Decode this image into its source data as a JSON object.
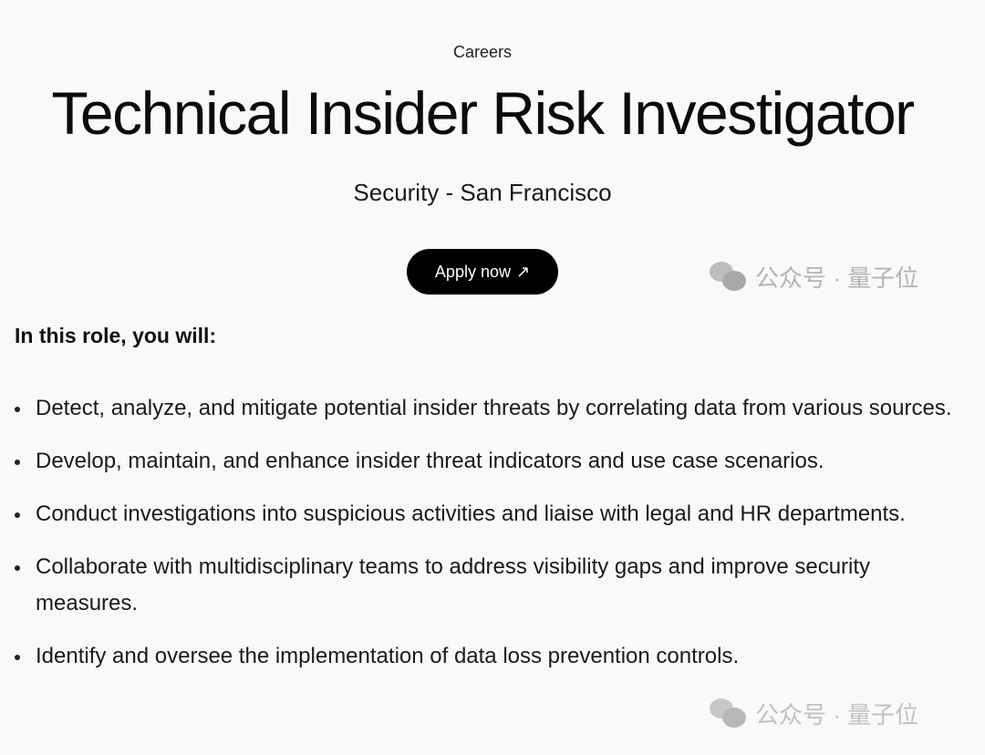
{
  "header": {
    "eyebrow": "Careers",
    "title": "Technical Insider Risk Investigator",
    "subtitle": "Security - San Francisco",
    "apply_label": "Apply now",
    "apply_icon": "↗"
  },
  "watermark": {
    "text": "公众号 · 量子位",
    "icon": "wechat-icon"
  },
  "section": {
    "heading": "In this role, you will:",
    "items": [
      "Detect, analyze, and mitigate potential insider threats by correlating data from various sources.",
      "Develop, maintain, and enhance insider threat indicators and use case scenarios.",
      "Conduct investigations into suspicious activities and liaise with legal and HR departments.",
      "Collaborate with multidisciplinary teams to address visibility gaps and improve security measures.",
      "Identify and oversee the implementation of data loss prevention controls."
    ]
  }
}
